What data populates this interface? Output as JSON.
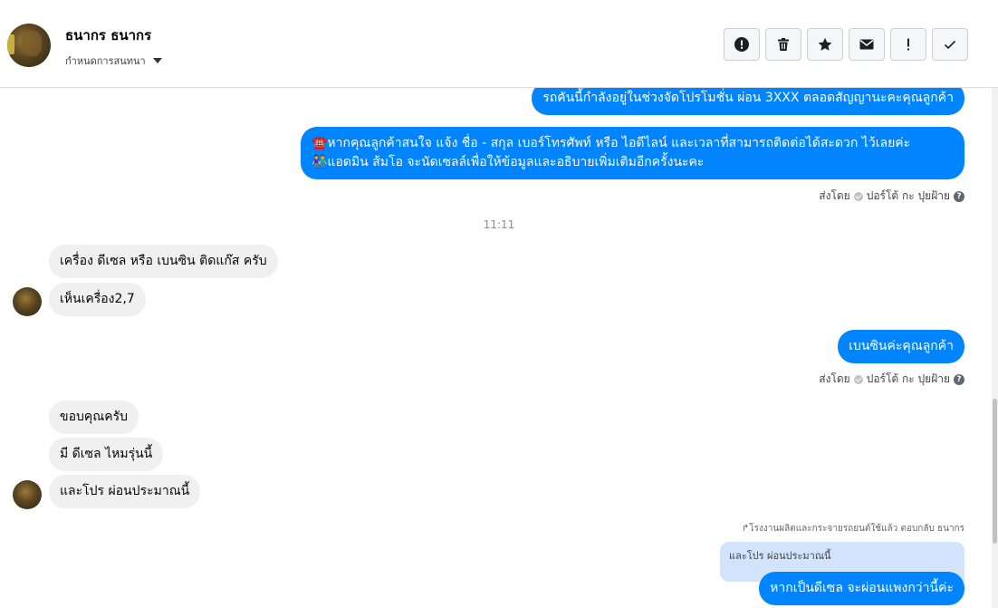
{
  "header": {
    "contact_name": "ธนากร ธนากร",
    "assign_label": "กำหนดการสนทนา",
    "toolbar": [
      {
        "icon": "alert-icon",
        "name": "spam-button"
      },
      {
        "icon": "trash-icon",
        "name": "delete-button"
      },
      {
        "icon": "star-icon",
        "name": "star-button"
      },
      {
        "icon": "envelope-icon",
        "name": "mark-unread-button"
      },
      {
        "icon": "exclamation-icon",
        "name": "follow-up-button"
      },
      {
        "icon": "check-icon",
        "name": "done-button"
      }
    ]
  },
  "messages": {
    "out1": "รถคันนี้กำลังอยู่ในช่วงจัดโปรโมชั่น ผ่อน 3XXX ตลอดสัญญานะคะคุณลูกค้า",
    "out2_line1": "☎️หากคุณลูกค้าสนใจ แจ้ง ชื่อ - สกุล เบอร์โทรศัพท์ หรือ ไอดีไลน์ และเวลาที่สามารถติดต่อได้สะดวก ไว้เลยค่ะ",
    "out2_line2": "👫แอดมิน ส้มโอ จะนัดเซลล์เพื่อให้ข้อมูลและอธิบายเพิ่มเติมอีกครั้งนะคะ",
    "sent_by_1": "ส่งโดย",
    "sent_by_name_1": "ปอร์โต้ กะ ปุยฝ้าย",
    "time": "11:11",
    "in1": "เครื่อง ดีเซล หรือ เบนซิน ติดแก๊ส ครับ",
    "in2": "เห็นเครื่อง2,7",
    "out3": "เบนซินค่ะคุณลูกค้า",
    "sent_by_2": "ส่งโดย",
    "sent_by_name_2": "ปอร์โต้ กะ ปุยฝ้าย",
    "in3": "ขอบคุณครับ",
    "in4": "มี ดีเซล ไหมรุ่นนี้",
    "in5": "และโปร ผ่อนประมาณนี้",
    "reply_label": "โรงงานผลิตและกระจายรถยนต์ใช้แล้ว ตอบกลับ ธนากร",
    "quoted": "และโปร ผ่อนประมาณนี้",
    "out4": "หากเป็นดีเซล จะผ่อนแพงกว่านี้ค่ะ"
  },
  "colors": {
    "outgoing": "#0084ff",
    "incoming": "#f0f0f0",
    "quote": "#d2e3fc"
  }
}
